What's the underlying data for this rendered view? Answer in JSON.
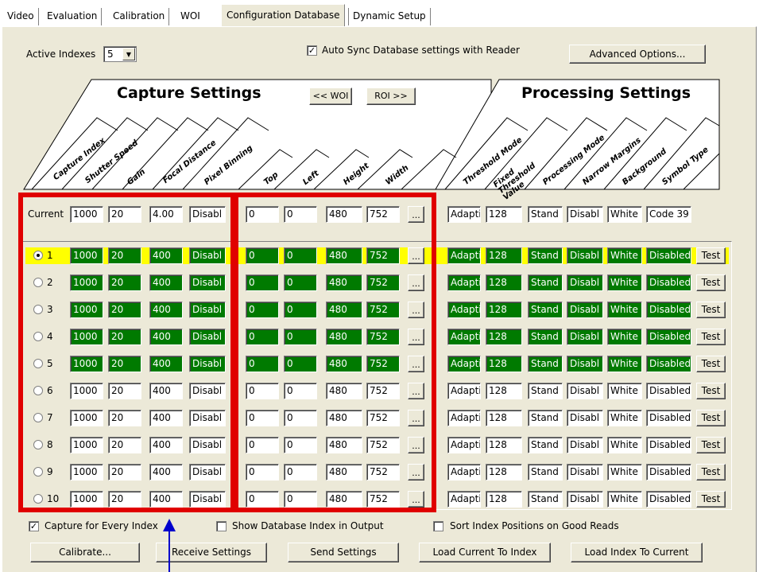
{
  "tabs": [
    "Video",
    "Evaluation",
    "Calibration",
    "WOI",
    "Configuration Database",
    "Dynamic Setup"
  ],
  "active_indexes": {
    "label": "Active Indexes",
    "value": "5"
  },
  "auto_sync": {
    "label": "Auto Sync Database settings with Reader",
    "checked": true
  },
  "advanced_button": "Advanced Options...",
  "capture_title": "Capture Settings",
  "processing_title": "Processing Settings",
  "woi_button": "<< WOI",
  "roi_button": "ROI >>",
  "capture_headers": [
    "Capture Index",
    "Shutter Speed",
    "Gain",
    "Focal Distance",
    "Pixel Binning"
  ],
  "woi_headers": [
    "Top",
    "Left",
    "Height",
    "Width"
  ],
  "processing_headers": [
    "Threshold Mode",
    "Fixed Threshold Value",
    "Processing Mode",
    "Narrow Margins",
    "Background",
    "Symbol Type"
  ],
  "current": {
    "label": "Current",
    "capture": [
      "1000",
      "20",
      "4.00",
      "Disabl"
    ],
    "woi": [
      "0",
      "0",
      "480",
      "752"
    ],
    "processing": [
      "Adapti",
      "128",
      "Stand",
      "Disabl",
      "White",
      "Code 39"
    ]
  },
  "ellipsis": "...",
  "test_label": "Test",
  "rows": [
    {
      "index": "1",
      "selected": true,
      "active": true,
      "capture": [
        "1000",
        "20",
        "400",
        "Disabl"
      ],
      "woi": [
        "0",
        "0",
        "480",
        "752"
      ],
      "processing": [
        "Adapti",
        "128",
        "Stand",
        "Disabl",
        "White",
        "Disabled"
      ]
    },
    {
      "index": "2",
      "selected": false,
      "active": true,
      "capture": [
        "1000",
        "20",
        "400",
        "Disabl"
      ],
      "woi": [
        "0",
        "0",
        "480",
        "752"
      ],
      "processing": [
        "Adapti",
        "128",
        "Stand",
        "Disabl",
        "White",
        "Disabled"
      ]
    },
    {
      "index": "3",
      "selected": false,
      "active": true,
      "capture": [
        "1000",
        "20",
        "400",
        "Disabl"
      ],
      "woi": [
        "0",
        "0",
        "480",
        "752"
      ],
      "processing": [
        "Adapti",
        "128",
        "Stand",
        "Disabl",
        "White",
        "Disabled"
      ]
    },
    {
      "index": "4",
      "selected": false,
      "active": true,
      "capture": [
        "1000",
        "20",
        "400",
        "Disabl"
      ],
      "woi": [
        "0",
        "0",
        "480",
        "752"
      ],
      "processing": [
        "Adapti",
        "128",
        "Stand",
        "Disabl",
        "White",
        "Disabled"
      ]
    },
    {
      "index": "5",
      "selected": false,
      "active": true,
      "capture": [
        "1000",
        "20",
        "400",
        "Disabl"
      ],
      "woi": [
        "0",
        "0",
        "480",
        "752"
      ],
      "processing": [
        "Adapti",
        "128",
        "Stand",
        "Disabl",
        "White",
        "Disabled"
      ]
    },
    {
      "index": "6",
      "selected": false,
      "active": false,
      "capture": [
        "1000",
        "20",
        "400",
        "Disabl"
      ],
      "woi": [
        "0",
        "0",
        "480",
        "752"
      ],
      "processing": [
        "Adapti",
        "128",
        "Stand",
        "Disabl",
        "White",
        "Disabled"
      ]
    },
    {
      "index": "7",
      "selected": false,
      "active": false,
      "capture": [
        "1000",
        "20",
        "400",
        "Disabl"
      ],
      "woi": [
        "0",
        "0",
        "480",
        "752"
      ],
      "processing": [
        "Adapti",
        "128",
        "Stand",
        "Disabl",
        "White",
        "Disabled"
      ]
    },
    {
      "index": "8",
      "selected": false,
      "active": false,
      "capture": [
        "1000",
        "20",
        "400",
        "Disabl"
      ],
      "woi": [
        "0",
        "0",
        "480",
        "752"
      ],
      "processing": [
        "Adapti",
        "128",
        "Stand",
        "Disabl",
        "White",
        "Disabled"
      ]
    },
    {
      "index": "9",
      "selected": false,
      "active": false,
      "capture": [
        "1000",
        "20",
        "400",
        "Disabl"
      ],
      "woi": [
        "0",
        "0",
        "480",
        "752"
      ],
      "processing": [
        "Adapti",
        "128",
        "Stand",
        "Disabl",
        "White",
        "Disabled"
      ]
    },
    {
      "index": "10",
      "selected": false,
      "active": false,
      "capture": [
        "1000",
        "20",
        "400",
        "Disabl"
      ],
      "woi": [
        "0",
        "0",
        "480",
        "752"
      ],
      "processing": [
        "Adapti",
        "128",
        "Stand",
        "Disabl",
        "White",
        "Disabled"
      ]
    }
  ],
  "options": [
    {
      "label": "Capture for Every Index",
      "checked": true
    },
    {
      "label": "Show Database Index in Output",
      "checked": false
    },
    {
      "label": "Sort Index Positions on Good Reads",
      "checked": false
    }
  ],
  "buttons": [
    "Calibrate...",
    "Receive Settings",
    "Send Settings",
    "Load Current To Index",
    "Load Index To Current"
  ],
  "colors": {
    "active_cell": "#007a00",
    "selected_row": "#ffff00",
    "highlight_box": "#e00000",
    "arrow": "#0000cc",
    "panel": "#ece9d8"
  }
}
